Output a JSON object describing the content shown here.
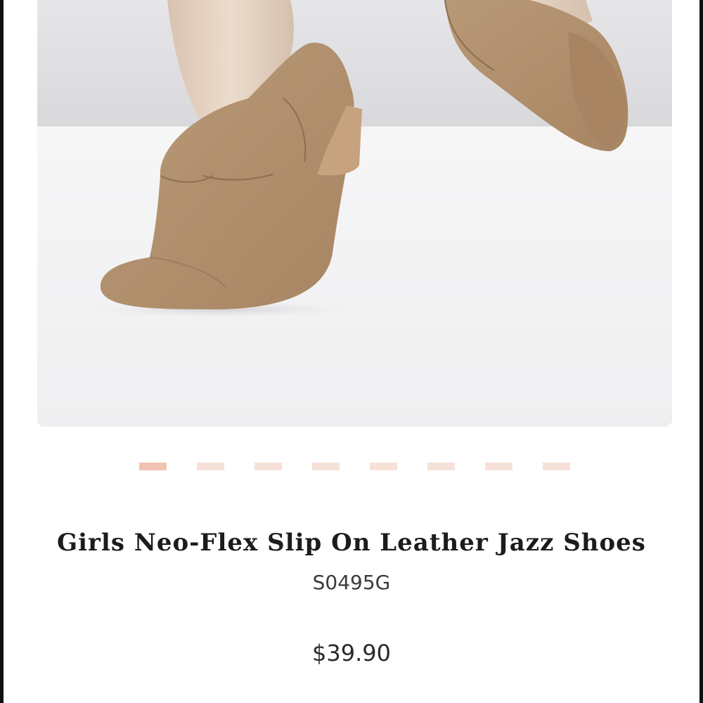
{
  "product": {
    "title": "Girls Neo-Flex Slip On Leather Jazz Shoes",
    "sku": "S0495G",
    "price": "$39.90"
  },
  "gallery": {
    "image_count": 8,
    "active_index": 0,
    "dot_color": "#f6e1d9",
    "dot_active_color": "#f1c3b2"
  }
}
